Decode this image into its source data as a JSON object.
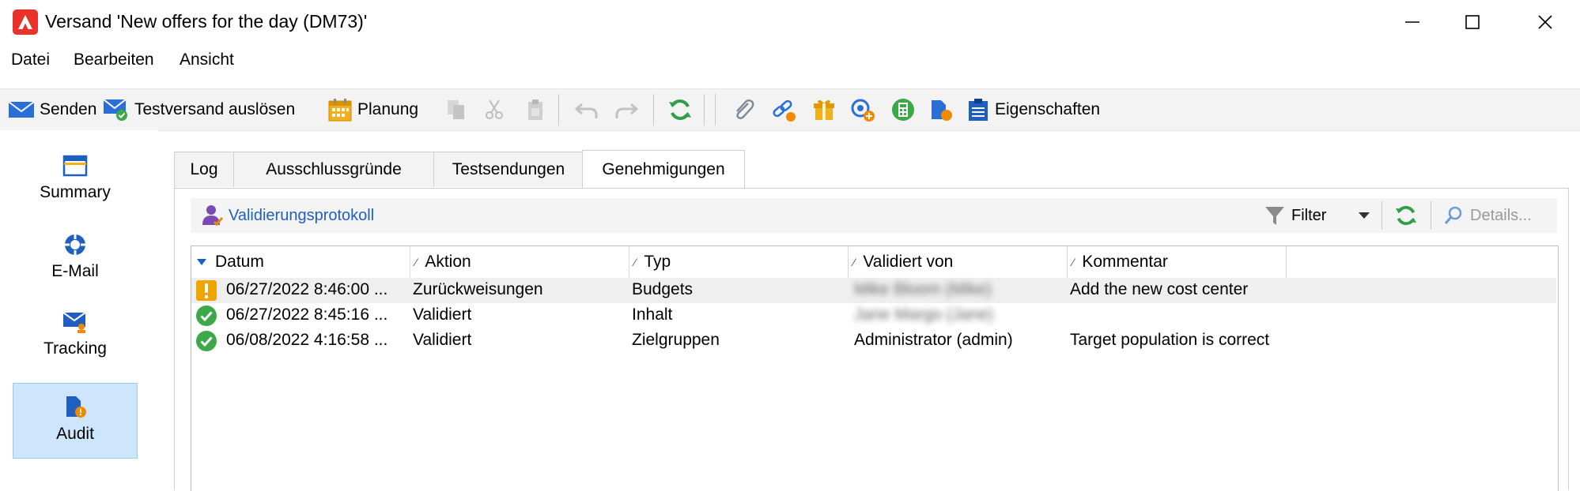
{
  "window": {
    "app_name": "Versand",
    "document_title": "'New offers for the day (DM73)'"
  },
  "menu": [
    "Datei",
    "Bearbeiten",
    "Ansicht"
  ],
  "toolbar": {
    "send_label": "Senden",
    "proof_label": "Testversand auslösen",
    "schedule_label": "Planung",
    "properties_label": "Eigenschaften"
  },
  "nav": {
    "items": [
      {
        "label": "Summary",
        "icon": "summary-window-icon",
        "active": false
      },
      {
        "label": "E-Mail",
        "icon": "email-lifebuoy-icon",
        "active": false
      },
      {
        "label": "Tracking",
        "icon": "tracking-envelope-icon",
        "active": false
      },
      {
        "label": "Audit",
        "icon": "audit-document-icon",
        "active": true
      }
    ]
  },
  "tabs": [
    "Log",
    "Ausschlussgründe",
    "Testsendungen",
    "Genehmigungen"
  ],
  "active_tab": "Genehmigungen",
  "panel_toolbar": {
    "validation_log_label": "Validierungsprotokoll",
    "filter_label": "Filter",
    "details_label": "Details..."
  },
  "grid": {
    "columns": [
      "Datum",
      "Aktion",
      "Typ",
      "Validiert von",
      "Kommentar"
    ],
    "rows": [
      {
        "status": "warning",
        "date": "06/27/2022 8:46:00 ...",
        "action": "Zurückweisungen",
        "type": "Budgets",
        "validated_by": "Mike Bloom (Mike)",
        "comment": "Add the new cost center"
      },
      {
        "status": "ok",
        "date": "06/27/2022 8:45:16 ...",
        "action": "Validiert",
        "type": "Inhalt",
        "validated_by": "Jane Margo (Jane)",
        "comment": ""
      },
      {
        "status": "ok",
        "date": "06/08/2022 4:16:58 ...",
        "action": "Validiert",
        "type": "Zielgruppen",
        "validated_by": "Administrator (admin)",
        "comment": "Target population is correct"
      }
    ]
  },
  "colors": {
    "accent_blue": "#1f5fbf",
    "ok_green": "#3da84a",
    "warning_orange": "#f0a400",
    "active_nav_bg": "#cde6fc",
    "brand_red": "#e8322a"
  }
}
